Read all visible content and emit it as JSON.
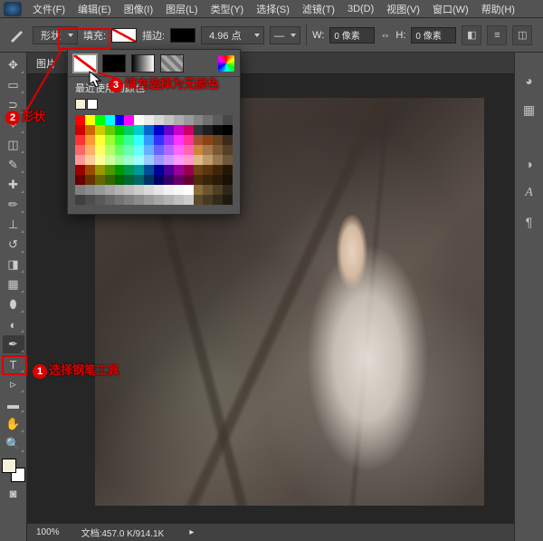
{
  "menu": {
    "items": [
      "文件(F)",
      "编辑(E)",
      "图像(I)",
      "图层(L)",
      "类型(Y)",
      "选择(S)",
      "滤镜(T)",
      "3D(D)",
      "视图(V)",
      "窗口(W)",
      "帮助(H)"
    ]
  },
  "options": {
    "mode_label": "形状",
    "fill_label": "填充:",
    "stroke_label": "描边:",
    "stroke_width": "4.96 点",
    "w_label": "W:",
    "w_value": "0 像素",
    "h_label": "H:",
    "h_value": "0 像素"
  },
  "tab": {
    "title": "图片"
  },
  "popup": {
    "recent_label": "最近使用的颜色",
    "recent": [
      "#f5f0d8",
      "#ffffff"
    ]
  },
  "status": {
    "zoom": "100%",
    "doc": "文档:457.0 K/914.1K"
  },
  "annotations": {
    "a1": {
      "num": "1",
      "text": "选择钢笔工具"
    },
    "a2": {
      "num": "2",
      "text": "形状"
    },
    "a3": {
      "num": "3",
      "text": "填充选择为无颜色"
    }
  },
  "swatch_rows": [
    [
      "#ff0000",
      "#ffff00",
      "#00ff00",
      "#00ffff",
      "#0000ff",
      "#ff00ff",
      "#ffffff",
      "#ebebeb",
      "#d6d6d6",
      "#c2c2c2",
      "#adadad",
      "#999999",
      "#858585",
      "#707070",
      "#5c5c5c",
      "#474747"
    ],
    [
      "#cc0000",
      "#cc6600",
      "#cccc00",
      "#66cc00",
      "#00cc00",
      "#00cc66",
      "#00cccc",
      "#0066cc",
      "#0000cc",
      "#6600cc",
      "#cc00cc",
      "#cc0066",
      "#333333",
      "#1f1f1f",
      "#0a0a0a",
      "#000000"
    ],
    [
      "#ff3333",
      "#ff9933",
      "#ffff33",
      "#99ff33",
      "#33ff33",
      "#33ff99",
      "#33ffff",
      "#3399ff",
      "#3333ff",
      "#9933ff",
      "#ff33ff",
      "#ff3399",
      "#a0522d",
      "#8b4513",
      "#654321",
      "#3b2a1a"
    ],
    [
      "#ff6666",
      "#ffb266",
      "#ffff66",
      "#b2ff66",
      "#66ff66",
      "#66ffb2",
      "#66ffff",
      "#66b2ff",
      "#6666ff",
      "#b266ff",
      "#ff66ff",
      "#ff66b2",
      "#cd853f",
      "#a0764a",
      "#7a5a36",
      "#554026"
    ],
    [
      "#ff9999",
      "#ffcc99",
      "#ffff99",
      "#ccff99",
      "#99ff99",
      "#99ffcc",
      "#99ffff",
      "#99ccff",
      "#9999ff",
      "#cc99ff",
      "#ff99ff",
      "#ff99cc",
      "#deb887",
      "#c19a6b",
      "#987650",
      "#6e563a"
    ],
    [
      "#990000",
      "#994c00",
      "#999900",
      "#4c9900",
      "#009900",
      "#00994c",
      "#009999",
      "#004c99",
      "#000099",
      "#4c0099",
      "#990099",
      "#99004c",
      "#704214",
      "#5a3610",
      "#3f260b",
      "#241607"
    ],
    [
      "#660000",
      "#663300",
      "#666600",
      "#336600",
      "#006600",
      "#006633",
      "#006666",
      "#003366",
      "#000066",
      "#330066",
      "#660066",
      "#660033",
      "#4a2c0a",
      "#3a2308",
      "#2a1a06",
      "#1a1004"
    ],
    [
      "#808080",
      "#8c8c8c",
      "#999999",
      "#a6a6a6",
      "#b3b3b3",
      "#bfbfbf",
      "#cccccc",
      "#d9d9d9",
      "#e6e6e6",
      "#f2f2f2",
      "#f8f8f8",
      "#ffffff",
      "#8a6d3b",
      "#6b5530",
      "#4d3e24",
      "#2f2718"
    ],
    [
      "#404040",
      "#4d4d4d",
      "#595959",
      "#666666",
      "#737373",
      "#7f7f7f",
      "#8c8c8c",
      "#999999",
      "#a6a6a6",
      "#b2b2b2",
      "#bfbfbf",
      "#cccccc",
      "#5c4a2a",
      "#473a22",
      "#332a19",
      "#1f1a10"
    ]
  ]
}
